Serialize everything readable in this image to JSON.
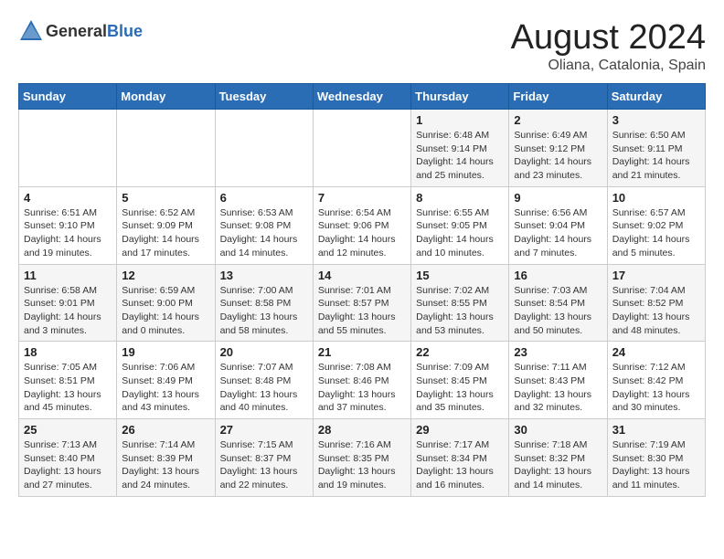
{
  "header": {
    "logo_general": "General",
    "logo_blue": "Blue",
    "month": "August 2024",
    "location": "Oliana, Catalonia, Spain"
  },
  "weekdays": [
    "Sunday",
    "Monday",
    "Tuesday",
    "Wednesday",
    "Thursday",
    "Friday",
    "Saturday"
  ],
  "weeks": [
    [
      {
        "day": "",
        "info": ""
      },
      {
        "day": "",
        "info": ""
      },
      {
        "day": "",
        "info": ""
      },
      {
        "day": "",
        "info": ""
      },
      {
        "day": "1",
        "info": "Sunrise: 6:48 AM\nSunset: 9:14 PM\nDaylight: 14 hours\nand 25 minutes."
      },
      {
        "day": "2",
        "info": "Sunrise: 6:49 AM\nSunset: 9:12 PM\nDaylight: 14 hours\nand 23 minutes."
      },
      {
        "day": "3",
        "info": "Sunrise: 6:50 AM\nSunset: 9:11 PM\nDaylight: 14 hours\nand 21 minutes."
      }
    ],
    [
      {
        "day": "4",
        "info": "Sunrise: 6:51 AM\nSunset: 9:10 PM\nDaylight: 14 hours\nand 19 minutes."
      },
      {
        "day": "5",
        "info": "Sunrise: 6:52 AM\nSunset: 9:09 PM\nDaylight: 14 hours\nand 17 minutes."
      },
      {
        "day": "6",
        "info": "Sunrise: 6:53 AM\nSunset: 9:08 PM\nDaylight: 14 hours\nand 14 minutes."
      },
      {
        "day": "7",
        "info": "Sunrise: 6:54 AM\nSunset: 9:06 PM\nDaylight: 14 hours\nand 12 minutes."
      },
      {
        "day": "8",
        "info": "Sunrise: 6:55 AM\nSunset: 9:05 PM\nDaylight: 14 hours\nand 10 minutes."
      },
      {
        "day": "9",
        "info": "Sunrise: 6:56 AM\nSunset: 9:04 PM\nDaylight: 14 hours\nand 7 minutes."
      },
      {
        "day": "10",
        "info": "Sunrise: 6:57 AM\nSunset: 9:02 PM\nDaylight: 14 hours\nand 5 minutes."
      }
    ],
    [
      {
        "day": "11",
        "info": "Sunrise: 6:58 AM\nSunset: 9:01 PM\nDaylight: 14 hours\nand 3 minutes."
      },
      {
        "day": "12",
        "info": "Sunrise: 6:59 AM\nSunset: 9:00 PM\nDaylight: 14 hours\nand 0 minutes."
      },
      {
        "day": "13",
        "info": "Sunrise: 7:00 AM\nSunset: 8:58 PM\nDaylight: 13 hours\nand 58 minutes."
      },
      {
        "day": "14",
        "info": "Sunrise: 7:01 AM\nSunset: 8:57 PM\nDaylight: 13 hours\nand 55 minutes."
      },
      {
        "day": "15",
        "info": "Sunrise: 7:02 AM\nSunset: 8:55 PM\nDaylight: 13 hours\nand 53 minutes."
      },
      {
        "day": "16",
        "info": "Sunrise: 7:03 AM\nSunset: 8:54 PM\nDaylight: 13 hours\nand 50 minutes."
      },
      {
        "day": "17",
        "info": "Sunrise: 7:04 AM\nSunset: 8:52 PM\nDaylight: 13 hours\nand 48 minutes."
      }
    ],
    [
      {
        "day": "18",
        "info": "Sunrise: 7:05 AM\nSunset: 8:51 PM\nDaylight: 13 hours\nand 45 minutes."
      },
      {
        "day": "19",
        "info": "Sunrise: 7:06 AM\nSunset: 8:49 PM\nDaylight: 13 hours\nand 43 minutes."
      },
      {
        "day": "20",
        "info": "Sunrise: 7:07 AM\nSunset: 8:48 PM\nDaylight: 13 hours\nand 40 minutes."
      },
      {
        "day": "21",
        "info": "Sunrise: 7:08 AM\nSunset: 8:46 PM\nDaylight: 13 hours\nand 37 minutes."
      },
      {
        "day": "22",
        "info": "Sunrise: 7:09 AM\nSunset: 8:45 PM\nDaylight: 13 hours\nand 35 minutes."
      },
      {
        "day": "23",
        "info": "Sunrise: 7:11 AM\nSunset: 8:43 PM\nDaylight: 13 hours\nand 32 minutes."
      },
      {
        "day": "24",
        "info": "Sunrise: 7:12 AM\nSunset: 8:42 PM\nDaylight: 13 hours\nand 30 minutes."
      }
    ],
    [
      {
        "day": "25",
        "info": "Sunrise: 7:13 AM\nSunset: 8:40 PM\nDaylight: 13 hours\nand 27 minutes."
      },
      {
        "day": "26",
        "info": "Sunrise: 7:14 AM\nSunset: 8:39 PM\nDaylight: 13 hours\nand 24 minutes."
      },
      {
        "day": "27",
        "info": "Sunrise: 7:15 AM\nSunset: 8:37 PM\nDaylight: 13 hours\nand 22 minutes."
      },
      {
        "day": "28",
        "info": "Sunrise: 7:16 AM\nSunset: 8:35 PM\nDaylight: 13 hours\nand 19 minutes."
      },
      {
        "day": "29",
        "info": "Sunrise: 7:17 AM\nSunset: 8:34 PM\nDaylight: 13 hours\nand 16 minutes."
      },
      {
        "day": "30",
        "info": "Sunrise: 7:18 AM\nSunset: 8:32 PM\nDaylight: 13 hours\nand 14 minutes."
      },
      {
        "day": "31",
        "info": "Sunrise: 7:19 AM\nSunset: 8:30 PM\nDaylight: 13 hours\nand 11 minutes."
      }
    ]
  ]
}
